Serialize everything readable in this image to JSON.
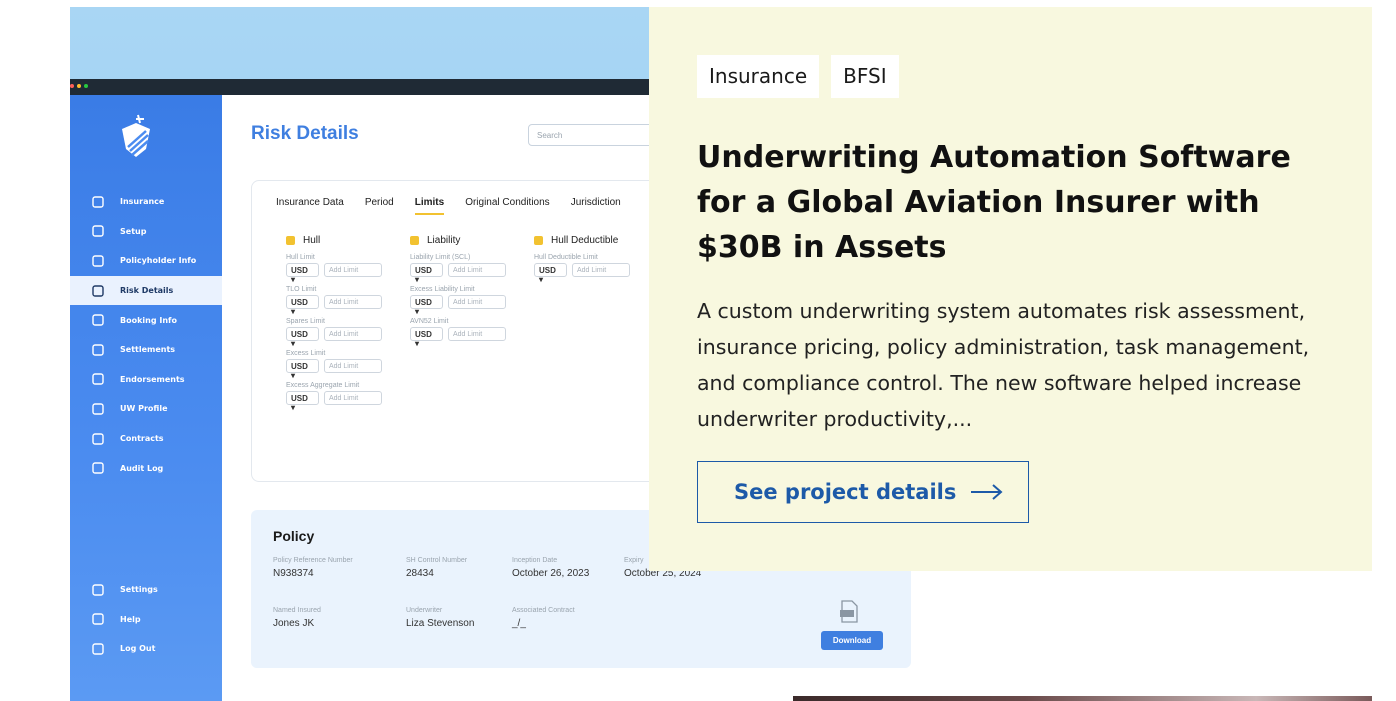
{
  "screenshot": {
    "app_title": "Risk Details",
    "search_placeholder": "Search",
    "nav": [
      {
        "label": "Insurance",
        "icon": "umbrella-icon"
      },
      {
        "label": "Setup",
        "icon": "sliders-icon"
      },
      {
        "label": "Policyholder Info",
        "icon": "document-icon"
      },
      {
        "label": "Risk Details",
        "icon": "warning-icon",
        "active": true
      },
      {
        "label": "Booking Info",
        "icon": "calendar-icon"
      },
      {
        "label": "Settlements",
        "icon": "settlement-icon"
      },
      {
        "label": "Endorsements",
        "icon": "endorsement-icon"
      },
      {
        "label": "UW Profile",
        "icon": "user-icon"
      },
      {
        "label": "Contracts",
        "icon": "contract-icon"
      },
      {
        "label": "Audit Log",
        "icon": "log-icon"
      }
    ],
    "nav_bottom": [
      {
        "label": "Settings",
        "icon": "gear-icon"
      },
      {
        "label": "Help",
        "icon": "help-icon"
      },
      {
        "label": "Log Out",
        "icon": "logout-icon"
      }
    ],
    "tabs": [
      "Insurance Data",
      "Period",
      "Limits",
      "Original Conditions",
      "Jurisdiction"
    ],
    "active_tab": "Limits",
    "columns": [
      {
        "title": "Hull",
        "fields": [
          {
            "label": "Hull Limit",
            "currency": "USD",
            "placeholder": "Add Limit"
          },
          {
            "label": "TLO Limit",
            "currency": "USD",
            "placeholder": "Add Limit"
          },
          {
            "label": "Spares Limit",
            "currency": "USD",
            "placeholder": "Add Limit"
          },
          {
            "label": "Excess Limit",
            "currency": "USD",
            "placeholder": "Add Limit"
          },
          {
            "label": "Excess Aggregate Limit",
            "currency": "USD",
            "placeholder": "Add Limit"
          }
        ]
      },
      {
        "title": "Liability",
        "fields": [
          {
            "label": "Liability Limit (SCL)",
            "currency": "USD",
            "placeholder": "Add Limit"
          },
          {
            "label": "Excess Liability Limit",
            "currency": "USD",
            "placeholder": "Add Limit"
          },
          {
            "label": "AVN52 Limit",
            "currency": "USD",
            "placeholder": "Add Limit"
          }
        ]
      },
      {
        "title": "Hull Deductible",
        "fields": [
          {
            "label": "Hull Deductible Limit",
            "currency": "USD",
            "placeholder": "Add Limit"
          }
        ]
      }
    ],
    "policy": {
      "title": "Policy",
      "fields": [
        {
          "label": "Policy Reference Number",
          "value": "N938374"
        },
        {
          "label": "SH Control Number",
          "value": "28434"
        },
        {
          "label": "Inception Date",
          "value": "October 26, 2023"
        },
        {
          "label": "Expiry",
          "value": "October 25, 2024"
        },
        {
          "label": "Named Insured",
          "value": "Jones JK"
        },
        {
          "label": "Underwriter",
          "value": "Liza Stevenson"
        },
        {
          "label": "Associated Contract",
          "value": "_/_"
        }
      ],
      "download_label": "Download"
    }
  },
  "panel": {
    "tags": [
      "Insurance",
      "BFSI"
    ],
    "title": "Underwriting Automation Software for a Global Aviation Insurer with $30B in Assets",
    "description": "A custom underwriting system automates risk assessment, insurance pricing, policy administration, task management, and compliance control. The new software helped increase underwriter productivity,...",
    "cta_label": "See project details",
    "colors": {
      "background": "#f8f8df",
      "accent": "#1d5aa8"
    }
  }
}
